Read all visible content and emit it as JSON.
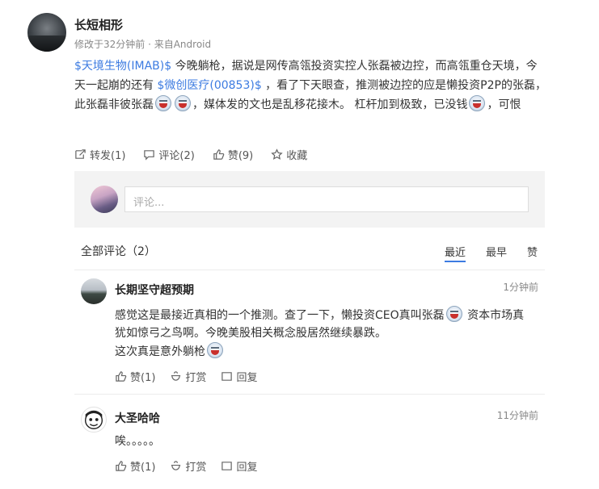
{
  "post": {
    "author": "长短相形",
    "meta": "修改于32分钟前 · 来自Android",
    "segments": [
      {
        "type": "tag",
        "text": "$天境生物(IMAB)$"
      },
      {
        "type": "text",
        "text": " 今晚躺枪，据说是网传高瓴投资实控人张磊被边控，而高瓴重仓天境，今天一起崩的还有 "
      },
      {
        "type": "tag",
        "text": "$微创医疗(00853)$"
      },
      {
        "type": "text",
        "text": " ，看了下天眼查，推测被边控的应是懒投资P2P的张磊，此张磊非彼张磊"
      },
      {
        "type": "emoji",
        "name": "cry-emoji"
      },
      {
        "type": "emoji",
        "name": "laugh-cry-emoji"
      },
      {
        "type": "text",
        "text": "，媒体发的文也是乱移花接木。 杠杆加到极致，已没钱"
      },
      {
        "type": "emoji",
        "name": "cry-emoji"
      },
      {
        "type": "text",
        "text": "，可恨"
      }
    ],
    "actions": {
      "repost": "转发(1)",
      "comment": "评论(2)",
      "like": "赞(9)",
      "favorite": "收藏"
    }
  },
  "comment_box": {
    "placeholder": "评论..."
  },
  "comments_header": {
    "title": "全部评论（2）",
    "sort": [
      "最近",
      "最早",
      "赞"
    ]
  },
  "comments": [
    {
      "name": "长期坚守超预期",
      "time": "1分钟前",
      "lines": [
        [
          {
            "type": "text",
            "text": "感觉这是最接近真相的一个推测。查了一下，懒投资CEO真叫张磊"
          },
          {
            "type": "emoji",
            "name": "laugh-cry-emoji"
          },
          {
            "type": "text",
            "text": " 资本市场真犹如惊弓之鸟啊。今晚美股相关概念股居然继续暴跌。"
          }
        ],
        [
          {
            "type": "text",
            "text": "这次真是意外躺枪"
          },
          {
            "type": "emoji",
            "name": "cry-emoji"
          }
        ]
      ],
      "like": "赞(1)",
      "reward": "打赏",
      "reply": "回复"
    },
    {
      "name": "大圣哈哈",
      "time": "11分钟前",
      "lines": [
        [
          {
            "type": "text",
            "text": "唉。。。。。"
          }
        ]
      ],
      "like": "赞(1)",
      "reward": "打赏",
      "reply": "回复"
    }
  ],
  "colors": {
    "link": "#3c7be1",
    "text": "#333333",
    "muted": "#888888",
    "box_bg": "#f3f3f3"
  }
}
